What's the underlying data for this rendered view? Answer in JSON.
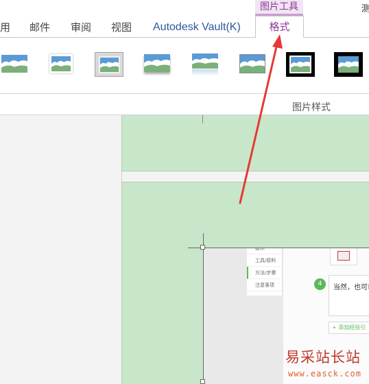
{
  "ribbon": {
    "context_label": "图片工具",
    "corner_text": "测",
    "tabs": {
      "yong": "用",
      "mail": "邮件",
      "review": "审阅",
      "view": "视图",
      "vault": "Autodesk Vault(K)",
      "format": "格式"
    },
    "gallery_group_label": "图片样式",
    "accent_color": "#8e3a98"
  },
  "embedded_screenshot": {
    "sidebar_items": [
      "提示",
      "工具/原料",
      "方法/步骤",
      "注意事项"
    ],
    "step_number": "4",
    "step_text": "当然，也可以",
    "add_link": "+ 添加经验引"
  },
  "watermark": {
    "text": "易采站长站",
    "url": "www.easck.com"
  }
}
